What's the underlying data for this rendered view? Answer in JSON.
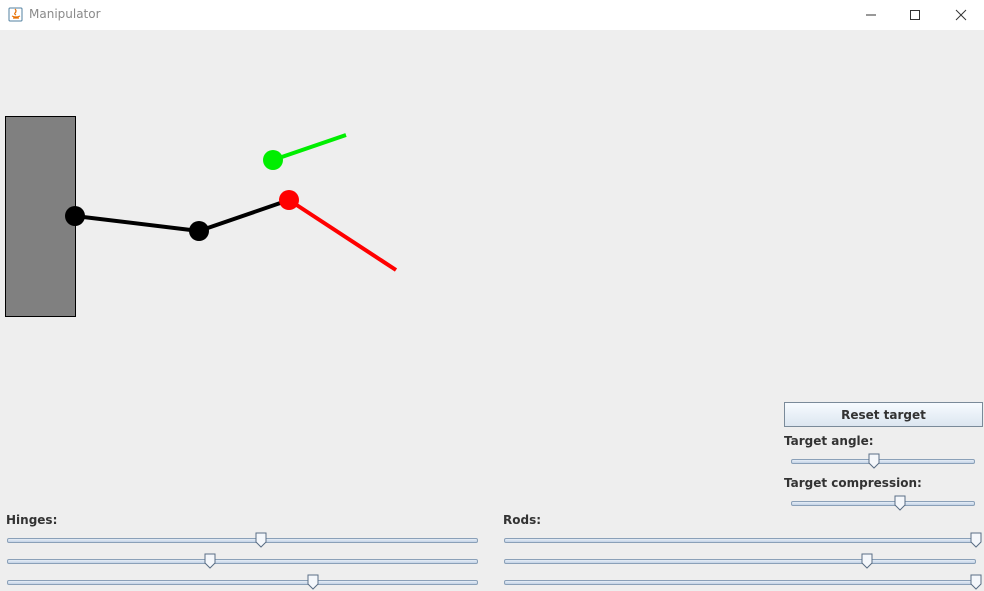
{
  "window": {
    "title": "Manipulator",
    "app_icon": "java-icon",
    "controls": [
      "minimize-icon",
      "maximize-icon",
      "close-icon"
    ]
  },
  "scene": {
    "wall_color": "#808080",
    "arm_color": "#000000",
    "joint_color": "#000000",
    "end_effector_color": "#ff0000",
    "target_color": "#00ee00"
  },
  "controls": {
    "reset_button": "Reset target",
    "target_angle_label": "Target angle:",
    "target_angle_value": 0.45,
    "target_compression_label": "Target compression:",
    "target_compression_value": 0.59,
    "hinges_label": "Hinges:",
    "hinges": [
      0.54,
      0.43,
      0.65
    ],
    "rods_label": "Rods:",
    "rods": [
      1.0,
      0.77,
      1.0
    ]
  }
}
